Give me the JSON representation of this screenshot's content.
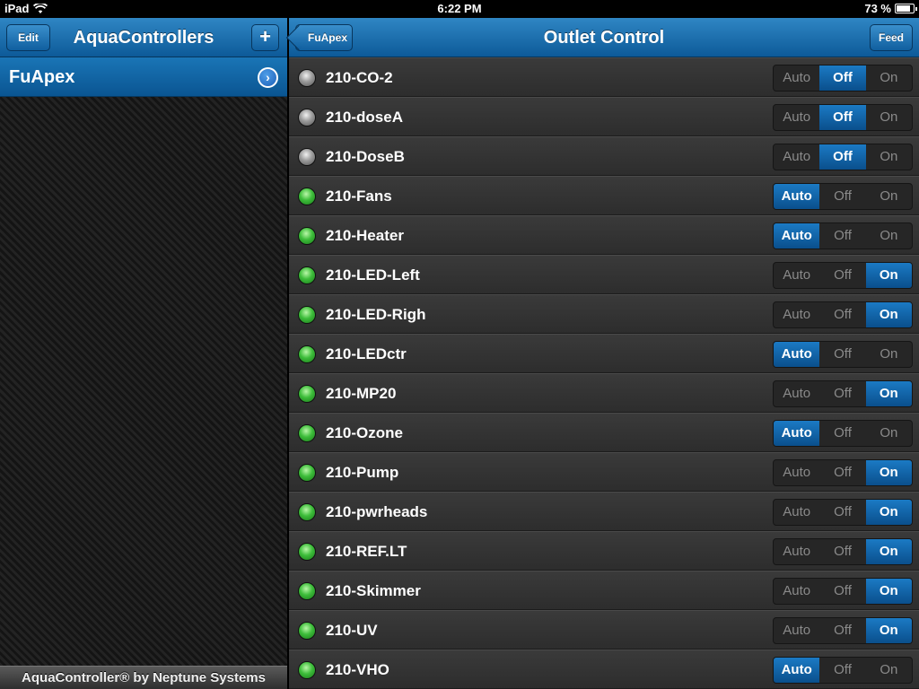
{
  "status": {
    "device": "iPad",
    "time": "6:22 PM",
    "battery": "73 %",
    "battery_level": 0.73
  },
  "left": {
    "title": "AquaControllers",
    "edit_label": "Edit",
    "add_label": "+",
    "controller_name": "FuApex",
    "footer": "AquaController® by Neptune Systems"
  },
  "right": {
    "title": "Outlet Control",
    "back_label": "FuApex",
    "feed_label": "Feed",
    "options": [
      "Auto",
      "Off",
      "On"
    ],
    "outlets": [
      {
        "name": "210-CO-2",
        "led": "gray",
        "state": "Off"
      },
      {
        "name": "210-doseA",
        "led": "gray",
        "state": "Off"
      },
      {
        "name": "210-DoseB",
        "led": "gray",
        "state": "Off"
      },
      {
        "name": "210-Fans",
        "led": "green",
        "state": "Auto"
      },
      {
        "name": "210-Heater",
        "led": "green",
        "state": "Auto"
      },
      {
        "name": "210-LED-Left",
        "led": "green",
        "state": "On"
      },
      {
        "name": "210-LED-Righ",
        "led": "green",
        "state": "On"
      },
      {
        "name": "210-LEDctr",
        "led": "green",
        "state": "Auto"
      },
      {
        "name": "210-MP20",
        "led": "green",
        "state": "On"
      },
      {
        "name": "210-Ozone",
        "led": "green",
        "state": "Auto"
      },
      {
        "name": "210-Pump",
        "led": "green",
        "state": "On"
      },
      {
        "name": "210-pwrheads",
        "led": "green",
        "state": "On"
      },
      {
        "name": "210-REF.LT",
        "led": "green",
        "state": "On"
      },
      {
        "name": "210-Skimmer",
        "led": "green",
        "state": "On"
      },
      {
        "name": "210-UV",
        "led": "green",
        "state": "On"
      },
      {
        "name": "210-VHO",
        "led": "green",
        "state": "Auto"
      }
    ]
  }
}
